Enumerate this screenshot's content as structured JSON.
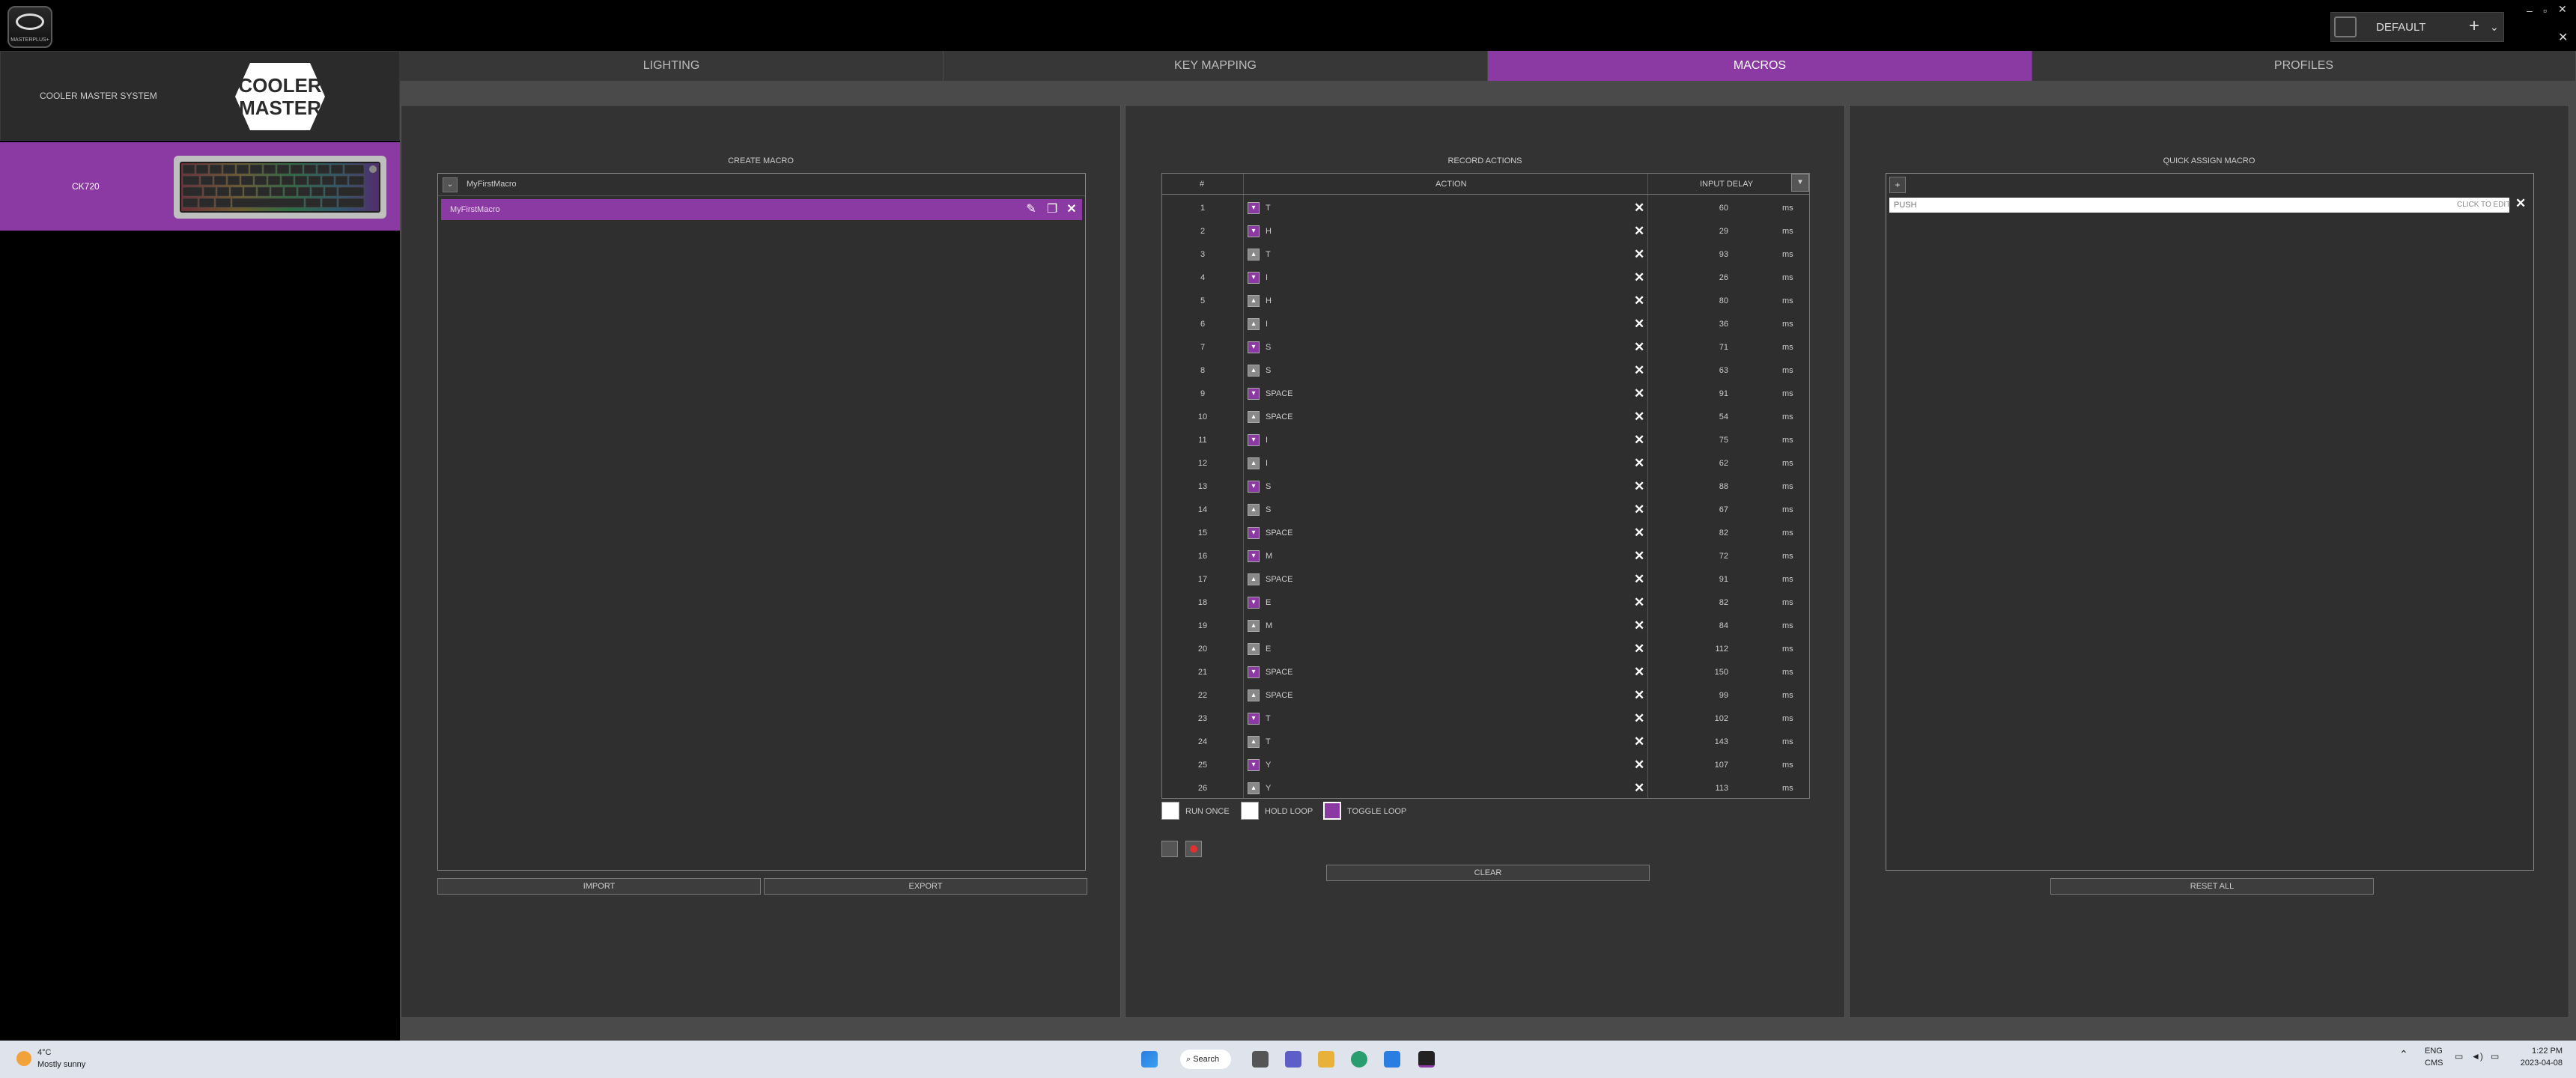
{
  "window": {
    "app_logo_text": "MASTERPLUS+",
    "profile_name": "DEFAULT"
  },
  "sidebar": {
    "system_label": "COOLER MASTER SYSTEM",
    "logo_text_1": "COOLER",
    "logo_text_2": "MASTER",
    "device_label": "CK720"
  },
  "tabs": [
    {
      "label": "LIGHTING",
      "active": false
    },
    {
      "label": "KEY MAPPING",
      "active": false
    },
    {
      "label": "MACROS",
      "active": true
    },
    {
      "label": "PROFILES",
      "active": false
    }
  ],
  "create_macro": {
    "title": "CREATE MACRO",
    "group_name": "MyFirstMacro",
    "selected_macro": "MyFirstMacro",
    "import_label": "IMPORT",
    "export_label": "EXPORT"
  },
  "record_actions": {
    "title": "RECORD ACTIONS",
    "col_num": "#",
    "col_action": "ACTION",
    "col_delay": "INPUT DELAY",
    "unit": "ms",
    "rows": [
      {
        "n": "1",
        "type": "down",
        "key": "T",
        "delay": "60"
      },
      {
        "n": "2",
        "type": "down",
        "key": "H",
        "delay": "29"
      },
      {
        "n": "3",
        "type": "up",
        "key": "T",
        "delay": "93"
      },
      {
        "n": "4",
        "type": "down",
        "key": "I",
        "delay": "26"
      },
      {
        "n": "5",
        "type": "up",
        "key": "H",
        "delay": "80"
      },
      {
        "n": "6",
        "type": "up",
        "key": "I",
        "delay": "36"
      },
      {
        "n": "7",
        "type": "down",
        "key": "S",
        "delay": "71"
      },
      {
        "n": "8",
        "type": "up",
        "key": "S",
        "delay": "63"
      },
      {
        "n": "9",
        "type": "down",
        "key": "SPACE",
        "delay": "91"
      },
      {
        "n": "10",
        "type": "up",
        "key": "SPACE",
        "delay": "54"
      },
      {
        "n": "11",
        "type": "down",
        "key": "I",
        "delay": "75"
      },
      {
        "n": "12",
        "type": "up",
        "key": "I",
        "delay": "62"
      },
      {
        "n": "13",
        "type": "down",
        "key": "S",
        "delay": "88"
      },
      {
        "n": "14",
        "type": "up",
        "key": "S",
        "delay": "67"
      },
      {
        "n": "15",
        "type": "down",
        "key": "SPACE",
        "delay": "82"
      },
      {
        "n": "16",
        "type": "down",
        "key": "M",
        "delay": "72"
      },
      {
        "n": "17",
        "type": "up",
        "key": "SPACE",
        "delay": "91"
      },
      {
        "n": "18",
        "type": "down",
        "key": "E",
        "delay": "82"
      },
      {
        "n": "19",
        "type": "up",
        "key": "M",
        "delay": "84"
      },
      {
        "n": "20",
        "type": "up",
        "key": "E",
        "delay": "112"
      },
      {
        "n": "21",
        "type": "down",
        "key": "SPACE",
        "delay": "150"
      },
      {
        "n": "22",
        "type": "up",
        "key": "SPACE",
        "delay": "99"
      },
      {
        "n": "23",
        "type": "down",
        "key": "T",
        "delay": "102"
      },
      {
        "n": "24",
        "type": "up",
        "key": "T",
        "delay": "143"
      },
      {
        "n": "25",
        "type": "down",
        "key": "Y",
        "delay": "107"
      },
      {
        "n": "26",
        "type": "up",
        "key": "Y",
        "delay": "113"
      }
    ],
    "run_once_label": "RUN ONCE",
    "hold_loop_label": "HOLD LOOP",
    "toggle_loop_label": "TOGGLE LOOP",
    "clear_label": "CLEAR"
  },
  "quick_assign": {
    "title": "QUICK ASSIGN MACRO",
    "add_label": "+",
    "input_placeholder": "PUSH",
    "click_to_edit": "CLICK TO EDIT",
    "reset_all_label": "RESET ALL"
  },
  "taskbar": {
    "weather_temp": "4°C",
    "weather_desc": "Mostly sunny",
    "search_label": "Search",
    "lang": "ENG",
    "region": "CMS",
    "time": "1:22 PM",
    "date": "2023-04-08"
  },
  "colors": {
    "accent": "#8c3aa3",
    "panel_bg": "#333333",
    "window_bg": "#4a4a4a"
  }
}
